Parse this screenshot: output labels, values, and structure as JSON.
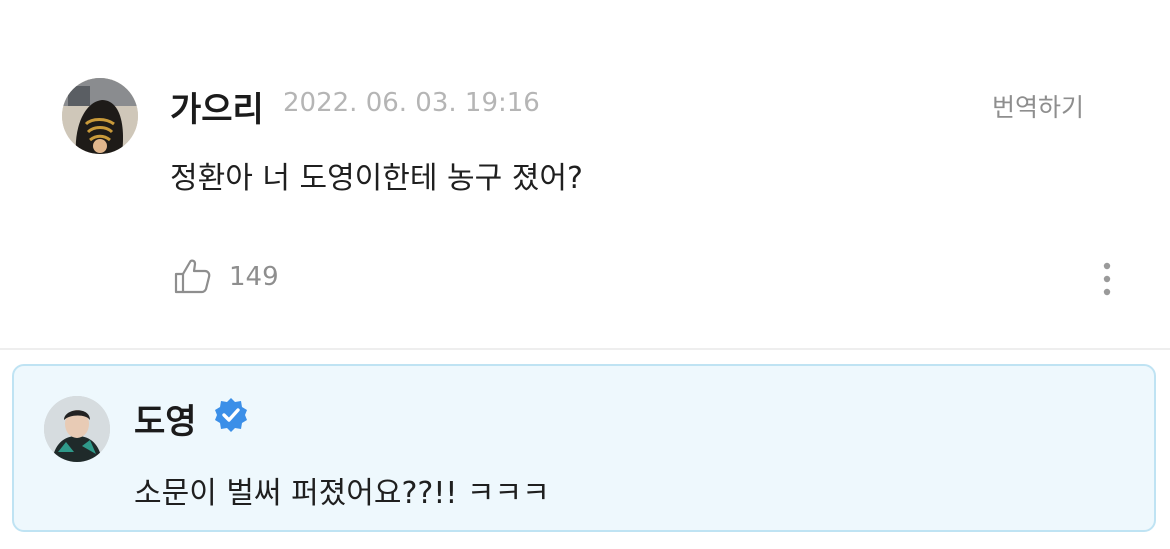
{
  "comment": {
    "author": "가으리",
    "date": "2022. 06. 03. 19:16",
    "translate_label": "번역하기",
    "text": "정환아 너 도영이한테 농구 졌어?",
    "like_count": "149"
  },
  "reply": {
    "author": "도영",
    "text": "소문이 벌써 퍼졌어요??!! ㅋㅋㅋ"
  },
  "colors": {
    "reply_background": "#eef8fd",
    "reply_border": "#bfe3f3",
    "verified": "#3b8fe8",
    "muted_text": "#8e8e8e"
  },
  "icons": [
    "like-icon",
    "more-options-icon",
    "verified-badge-icon"
  ]
}
